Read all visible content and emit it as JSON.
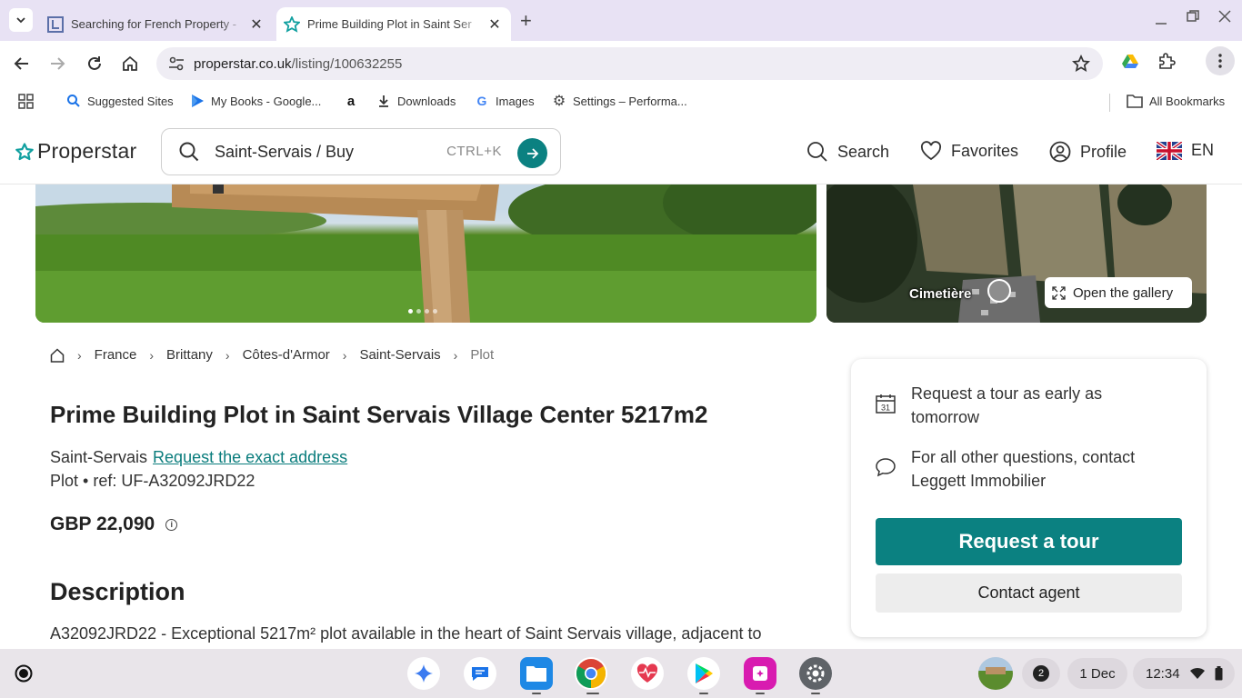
{
  "browser": {
    "tabs": [
      {
        "title": "Searching for French Property -",
        "active": false
      },
      {
        "title": "Prime Building Plot in Saint Ser",
        "active": true
      }
    ],
    "url_host": "properstar.co.uk",
    "url_path": "/listing/100632255",
    "bookmarks": [
      {
        "label": "Suggested Sites",
        "icon": "search-icon"
      },
      {
        "label": "My Books - Google...",
        "icon": "google-play-books-icon"
      },
      {
        "label": "",
        "icon": "amazon-icon"
      },
      {
        "label": "Downloads",
        "icon": "download-icon"
      },
      {
        "label": "Images",
        "icon": "google-icon"
      },
      {
        "label": "Settings – Performa...",
        "icon": "gear-icon"
      }
    ],
    "all_bookmarks": "All Bookmarks"
  },
  "site": {
    "logo": "Properstar",
    "search_value": "Saint-Servais / Buy",
    "search_shortcut": "CTRL+K",
    "nav": {
      "search": "Search",
      "favorites": "Favorites",
      "profile": "Profile",
      "language": "EN"
    },
    "accent": "#0b8181"
  },
  "gallery": {
    "map_label": "Cimetière",
    "open_gallery": "Open the gallery",
    "photo_count_dots": 4
  },
  "breadcrumb": [
    "France",
    "Brittany",
    "Côtes-d'Armor",
    "Saint-Servais",
    "Plot"
  ],
  "listing": {
    "title": "Prime Building Plot in Saint Servais Village Center 5217m2",
    "location": "Saint-Servais",
    "address_link": "Request the exact address",
    "type_ref": "Plot • ref: UF-A32092JRD22",
    "price": "GBP 22,090",
    "description_heading": "Description",
    "description_text": "A32092JRD22 - Exceptional 5217m² plot available in the heart of Saint Servais village, adjacent to"
  },
  "contact_card": {
    "tour_line1": "Request a tour as early as",
    "tour_line2": "tomorrow",
    "calendar_day": "31",
    "contact_line1": "For all other questions, contact",
    "contact_line2": "Leggett Immobilier",
    "request_tour": "Request a tour",
    "contact_agent": "Contact agent"
  },
  "shelf": {
    "notification_count": "2",
    "date": "1 Dec",
    "time": "12:34"
  }
}
